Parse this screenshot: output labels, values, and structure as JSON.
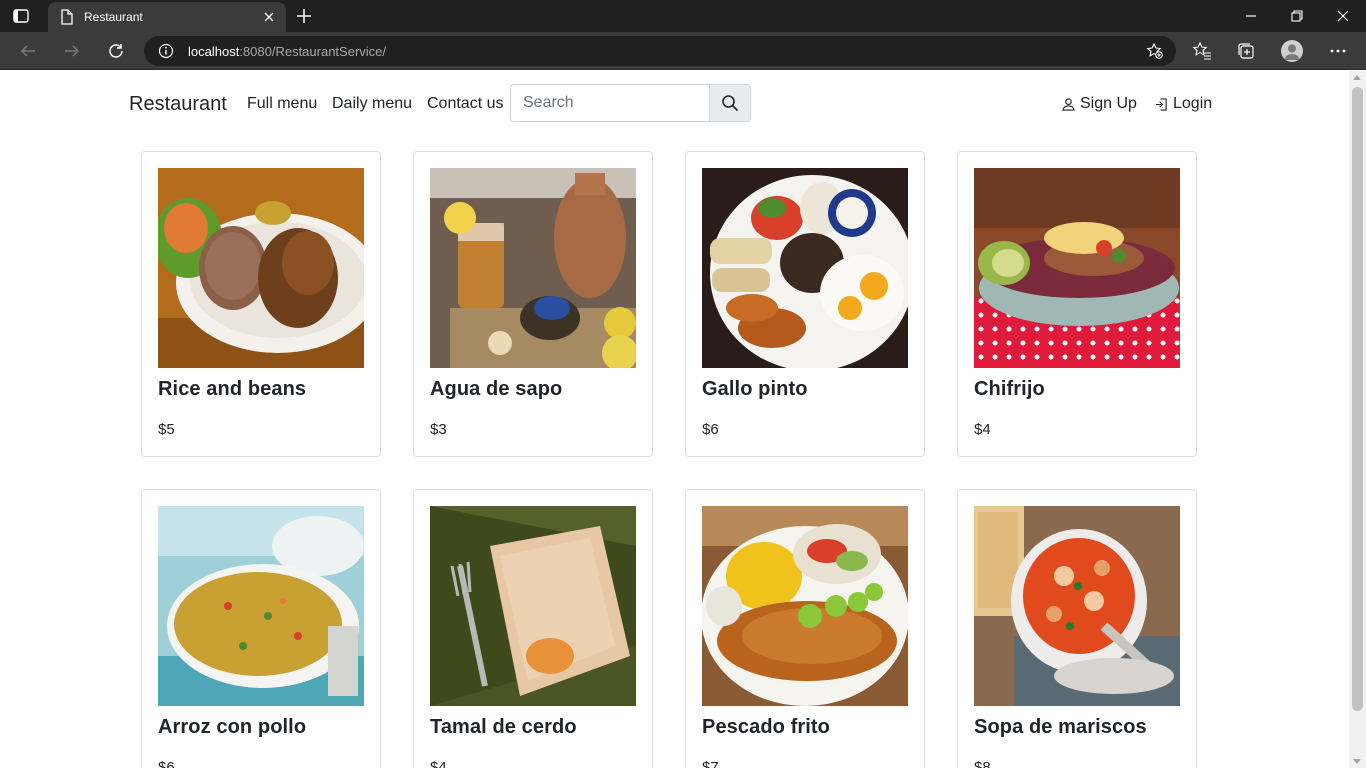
{
  "browser": {
    "tab_title": "Restaurant",
    "url_host": "localhost",
    "url_rest": ":8080/RestaurantService/"
  },
  "site": {
    "brand": "Restaurant",
    "nav": [
      "Full menu",
      "Daily menu",
      "Contact us"
    ],
    "search_placeholder": "Search",
    "signup": "Sign Up",
    "login": "Login"
  },
  "menu": [
    {
      "name": "Rice and beans",
      "price": "$5"
    },
    {
      "name": "Agua de sapo",
      "price": "$3"
    },
    {
      "name": "Gallo pinto",
      "price": "$6"
    },
    {
      "name": "Chifrijo",
      "price": "$4"
    },
    {
      "name": "Arroz con pollo",
      "price": "$6"
    },
    {
      "name": "Tamal de cerdo",
      "price": "$4"
    },
    {
      "name": "Pescado frito",
      "price": "$7"
    },
    {
      "name": "Sopa de mariscos",
      "price": "$8"
    }
  ],
  "colors": {
    "chrome_dark": "#202020",
    "chrome_mid": "#3b3b3b",
    "text": "#212529",
    "border": "#dee2e6"
  }
}
